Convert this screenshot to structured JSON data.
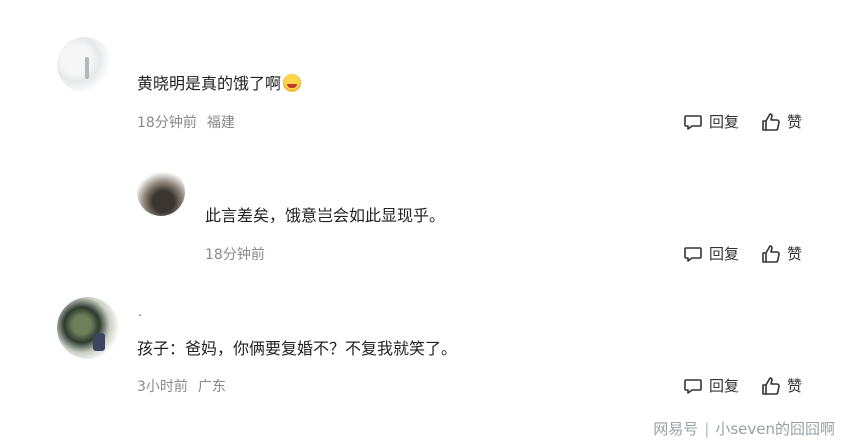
{
  "comments": [
    {
      "text": "黄晓明是真的饿了啊",
      "emoji": "smile-emoji",
      "time": "18分钟前",
      "location": "福建",
      "reply_label": "回复",
      "like_label": "赞"
    },
    {
      "text": "此言差矣，饿意岂会如此显现乎。",
      "time": "18分钟前",
      "reply_label": "回复",
      "like_label": "赞"
    },
    {
      "username": ".",
      "text": "孩子：爸妈，你俩要复婚不？不复我就笑了。",
      "time": "3小时前",
      "location": "广东",
      "reply_label": "回复",
      "like_label": "赞"
    }
  ],
  "watermark": {
    "brand": "网易号",
    "separator": "|",
    "author": "小seven的囧囧啊"
  }
}
